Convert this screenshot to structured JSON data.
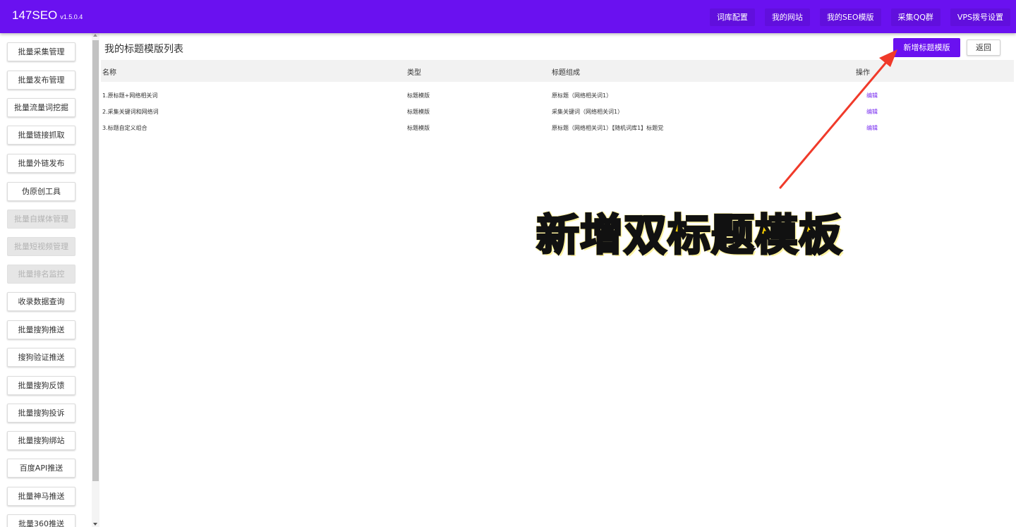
{
  "app": {
    "title": "147SEO",
    "version": "v1.5.0.4"
  },
  "nav": [
    {
      "label": "词库配置"
    },
    {
      "label": "我的网站"
    },
    {
      "label": "我的SEO模版"
    },
    {
      "label": "采集QQ群"
    },
    {
      "label": "VPS拨号设置"
    }
  ],
  "sidebar": {
    "items": [
      {
        "label": "批量采集管理",
        "enabled": true
      },
      {
        "label": "批量发布管理",
        "enabled": true
      },
      {
        "label": "批量流量词挖掘",
        "enabled": true
      },
      {
        "label": "批量链接抓取",
        "enabled": true
      },
      {
        "label": "批量外链发布",
        "enabled": true
      },
      {
        "label": "伪原创工具",
        "enabled": true
      },
      {
        "label": "批量自媒体管理",
        "enabled": false
      },
      {
        "label": "批量短视频管理",
        "enabled": false
      },
      {
        "label": "批量排名监控",
        "enabled": false
      },
      {
        "label": "收录数据查询",
        "enabled": true
      },
      {
        "label": "批量搜狗推送",
        "enabled": true
      },
      {
        "label": "搜狗验证推送",
        "enabled": true
      },
      {
        "label": "批量搜狗反馈",
        "enabled": true
      },
      {
        "label": "批量搜狗投诉",
        "enabled": true
      },
      {
        "label": "批量搜狗绑站",
        "enabled": true
      },
      {
        "label": "百度API推送",
        "enabled": true
      },
      {
        "label": "批量神马推送",
        "enabled": true
      },
      {
        "label": "批量360推送",
        "enabled": true
      }
    ]
  },
  "main": {
    "title": "我的标题模版列表",
    "add_button": "新增标题模版",
    "back_button": "返回",
    "columns": [
      "名称",
      "类型",
      "标题组成",
      "操作"
    ],
    "rows": [
      {
        "name": "1.原标题+网络相关词",
        "type": "标题模版",
        "composition": "原标题（网络相关词1）",
        "action": "编辑"
      },
      {
        "name": "2.采集关键词和网络词",
        "type": "标题模版",
        "composition": "采集关键词（网络相关词1）",
        "action": "编辑"
      },
      {
        "name": "3.标题自定义组合",
        "type": "标题模版",
        "composition": "原标题（网络相关词1）【随机词库1】标题党",
        "action": "编辑"
      }
    ]
  },
  "annotation": {
    "text": "新增双标题模板",
    "color": "#ffd400",
    "arrow_color": "#f03a2a"
  },
  "colors": {
    "brand": "#6a11f0",
    "link": "#7a2ff0"
  }
}
